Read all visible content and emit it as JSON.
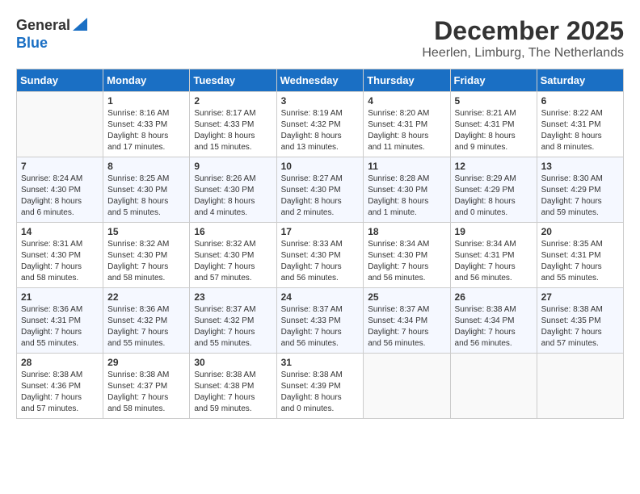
{
  "header": {
    "logo_general": "General",
    "logo_blue": "Blue",
    "month_title": "December 2025",
    "location": "Heerlen, Limburg, The Netherlands"
  },
  "weekdays": [
    "Sunday",
    "Monday",
    "Tuesday",
    "Wednesday",
    "Thursday",
    "Friday",
    "Saturday"
  ],
  "weeks": [
    [
      {
        "day": "",
        "info": ""
      },
      {
        "day": "1",
        "info": "Sunrise: 8:16 AM\nSunset: 4:33 PM\nDaylight: 8 hours\nand 17 minutes."
      },
      {
        "day": "2",
        "info": "Sunrise: 8:17 AM\nSunset: 4:33 PM\nDaylight: 8 hours\nand 15 minutes."
      },
      {
        "day": "3",
        "info": "Sunrise: 8:19 AM\nSunset: 4:32 PM\nDaylight: 8 hours\nand 13 minutes."
      },
      {
        "day": "4",
        "info": "Sunrise: 8:20 AM\nSunset: 4:31 PM\nDaylight: 8 hours\nand 11 minutes."
      },
      {
        "day": "5",
        "info": "Sunrise: 8:21 AM\nSunset: 4:31 PM\nDaylight: 8 hours\nand 9 minutes."
      },
      {
        "day": "6",
        "info": "Sunrise: 8:22 AM\nSunset: 4:31 PM\nDaylight: 8 hours\nand 8 minutes."
      }
    ],
    [
      {
        "day": "7",
        "info": "Sunrise: 8:24 AM\nSunset: 4:30 PM\nDaylight: 8 hours\nand 6 minutes."
      },
      {
        "day": "8",
        "info": "Sunrise: 8:25 AM\nSunset: 4:30 PM\nDaylight: 8 hours\nand 5 minutes."
      },
      {
        "day": "9",
        "info": "Sunrise: 8:26 AM\nSunset: 4:30 PM\nDaylight: 8 hours\nand 4 minutes."
      },
      {
        "day": "10",
        "info": "Sunrise: 8:27 AM\nSunset: 4:30 PM\nDaylight: 8 hours\nand 2 minutes."
      },
      {
        "day": "11",
        "info": "Sunrise: 8:28 AM\nSunset: 4:30 PM\nDaylight: 8 hours\nand 1 minute."
      },
      {
        "day": "12",
        "info": "Sunrise: 8:29 AM\nSunset: 4:29 PM\nDaylight: 8 hours\nand 0 minutes."
      },
      {
        "day": "13",
        "info": "Sunrise: 8:30 AM\nSunset: 4:29 PM\nDaylight: 7 hours\nand 59 minutes."
      }
    ],
    [
      {
        "day": "14",
        "info": "Sunrise: 8:31 AM\nSunset: 4:30 PM\nDaylight: 7 hours\nand 58 minutes."
      },
      {
        "day": "15",
        "info": "Sunrise: 8:32 AM\nSunset: 4:30 PM\nDaylight: 7 hours\nand 58 minutes."
      },
      {
        "day": "16",
        "info": "Sunrise: 8:32 AM\nSunset: 4:30 PM\nDaylight: 7 hours\nand 57 minutes."
      },
      {
        "day": "17",
        "info": "Sunrise: 8:33 AM\nSunset: 4:30 PM\nDaylight: 7 hours\nand 56 minutes."
      },
      {
        "day": "18",
        "info": "Sunrise: 8:34 AM\nSunset: 4:30 PM\nDaylight: 7 hours\nand 56 minutes."
      },
      {
        "day": "19",
        "info": "Sunrise: 8:34 AM\nSunset: 4:31 PM\nDaylight: 7 hours\nand 56 minutes."
      },
      {
        "day": "20",
        "info": "Sunrise: 8:35 AM\nSunset: 4:31 PM\nDaylight: 7 hours\nand 55 minutes."
      }
    ],
    [
      {
        "day": "21",
        "info": "Sunrise: 8:36 AM\nSunset: 4:31 PM\nDaylight: 7 hours\nand 55 minutes."
      },
      {
        "day": "22",
        "info": "Sunrise: 8:36 AM\nSunset: 4:32 PM\nDaylight: 7 hours\nand 55 minutes."
      },
      {
        "day": "23",
        "info": "Sunrise: 8:37 AM\nSunset: 4:32 PM\nDaylight: 7 hours\nand 55 minutes."
      },
      {
        "day": "24",
        "info": "Sunrise: 8:37 AM\nSunset: 4:33 PM\nDaylight: 7 hours\nand 56 minutes."
      },
      {
        "day": "25",
        "info": "Sunrise: 8:37 AM\nSunset: 4:34 PM\nDaylight: 7 hours\nand 56 minutes."
      },
      {
        "day": "26",
        "info": "Sunrise: 8:38 AM\nSunset: 4:34 PM\nDaylight: 7 hours\nand 56 minutes."
      },
      {
        "day": "27",
        "info": "Sunrise: 8:38 AM\nSunset: 4:35 PM\nDaylight: 7 hours\nand 57 minutes."
      }
    ],
    [
      {
        "day": "28",
        "info": "Sunrise: 8:38 AM\nSunset: 4:36 PM\nDaylight: 7 hours\nand 57 minutes."
      },
      {
        "day": "29",
        "info": "Sunrise: 8:38 AM\nSunset: 4:37 PM\nDaylight: 7 hours\nand 58 minutes."
      },
      {
        "day": "30",
        "info": "Sunrise: 8:38 AM\nSunset: 4:38 PM\nDaylight: 7 hours\nand 59 minutes."
      },
      {
        "day": "31",
        "info": "Sunrise: 8:38 AM\nSunset: 4:39 PM\nDaylight: 8 hours\nand 0 minutes."
      },
      {
        "day": "",
        "info": ""
      },
      {
        "day": "",
        "info": ""
      },
      {
        "day": "",
        "info": ""
      }
    ]
  ]
}
